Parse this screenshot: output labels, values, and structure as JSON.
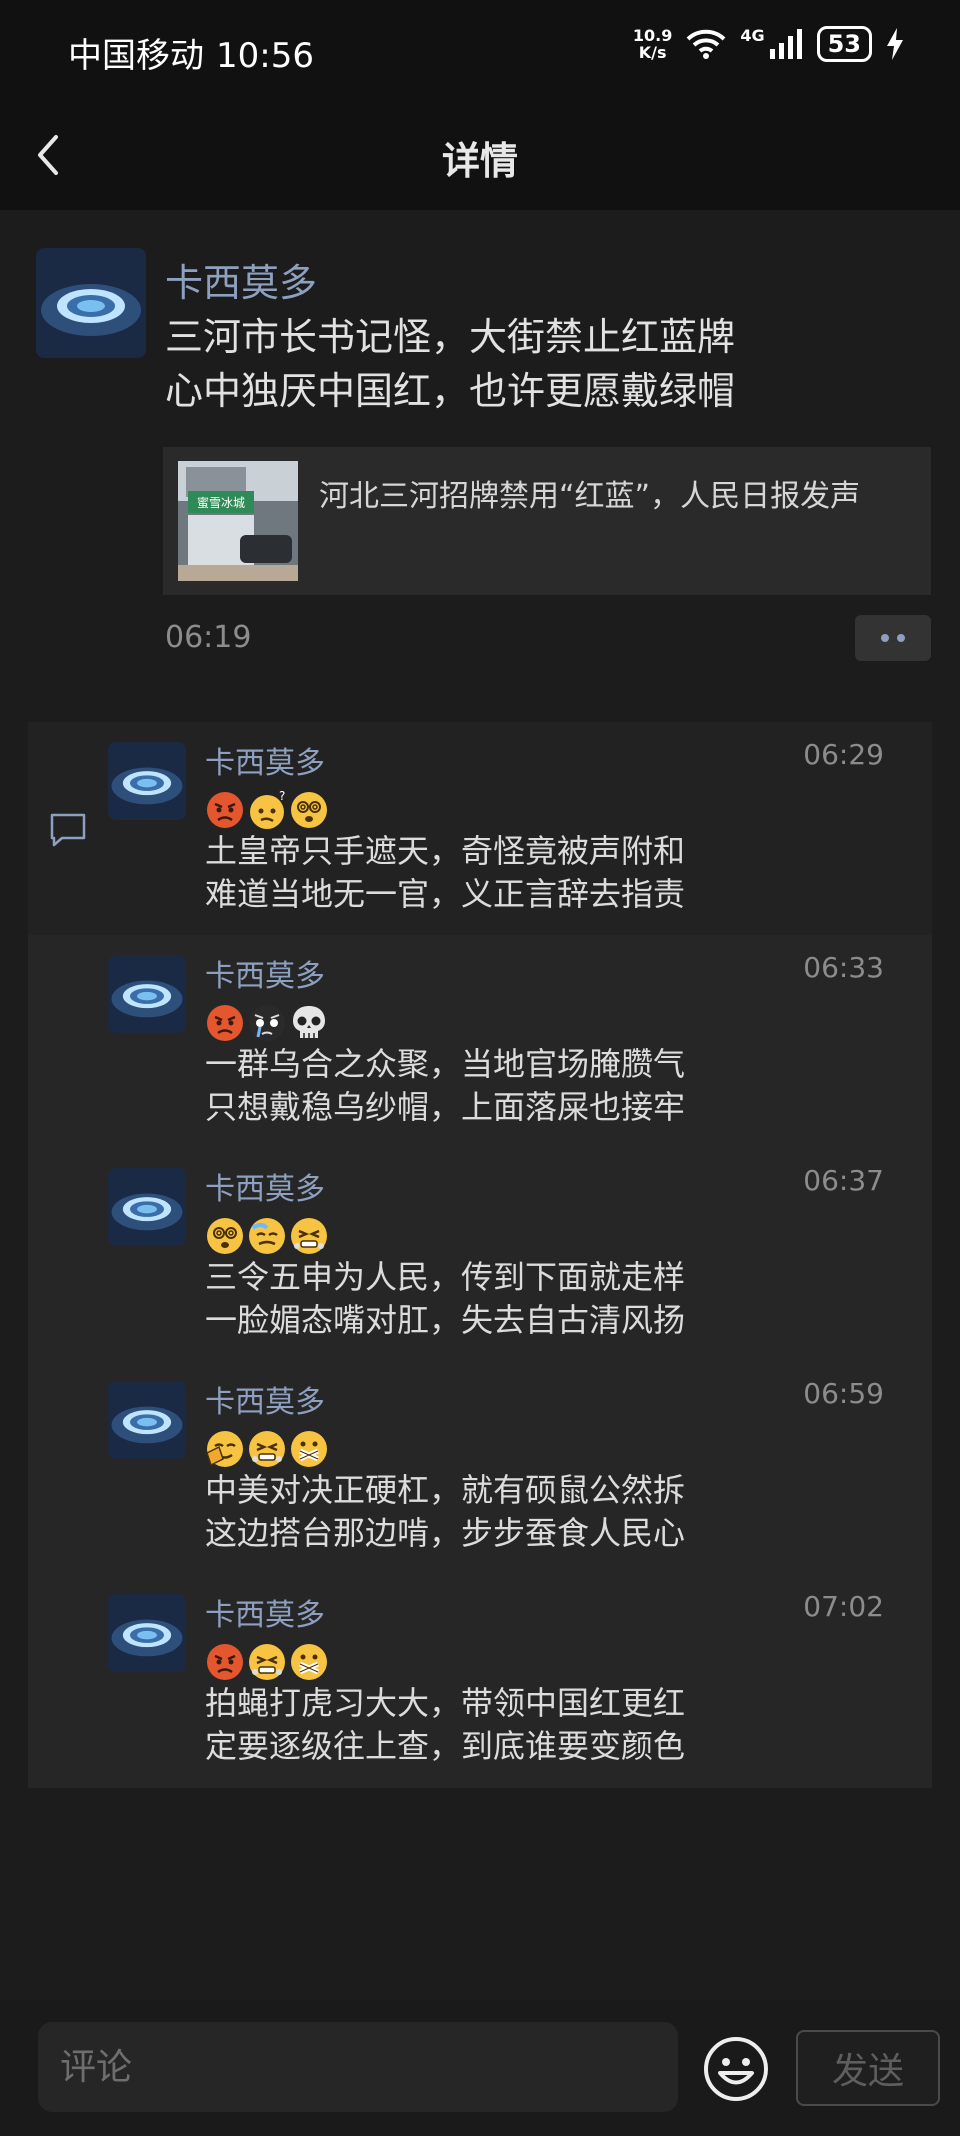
{
  "status_bar": {
    "carrier": "中国移动",
    "time": "10:56",
    "net_speed_value": "10.9",
    "net_speed_unit": "K/s",
    "network_type": "4G",
    "battery": "53"
  },
  "header": {
    "title": "详情",
    "back_icon": "chevron-left-icon"
  },
  "post": {
    "author": "卡西莫多",
    "text_line1": "三河市长书记怪，大街禁止红蓝牌",
    "text_line2": "心中独厌中国红，也许更愿戴绿帽",
    "link_title": "河北三河招牌禁用“红蓝”，人民日报发声",
    "thumb_sign_text": "蜜雪冰城",
    "time": "06:19"
  },
  "comments": [
    {
      "author": "卡西莫多",
      "time": "06:29",
      "emojis": [
        "angry-face-icon",
        "confused-face-icon",
        "dizzy-face-icon"
      ],
      "line1": "土皇帝只手遮天，奇怪竟被声附和",
      "line2": "难道当地无一官，义正言辞去指责"
    },
    {
      "author": "卡西莫多",
      "time": "06:33",
      "emojis": [
        "angry-face-icon",
        "crying-face-icon",
        "skull-icon"
      ],
      "line1": "一群乌合之众聚，当地官场腌臜气",
      "line2": "只想戴稳乌纱帽，上面落屎也接牢"
    },
    {
      "author": "卡西莫多",
      "time": "06:37",
      "emojis": [
        "dizzy-face-icon",
        "sweat-face-icon",
        "triumph-face-icon"
      ],
      "line1": "三令五申为人民，传到下面就走样",
      "line2": "一脸媚态嘴对肛，失去自古清风扬"
    },
    {
      "author": "卡西莫多",
      "time": "06:59",
      "emojis": [
        "facepalm-icon",
        "triumph-face-icon",
        "zipped-mouth-icon"
      ],
      "line1": "中美对决正硬杠，就有硕鼠公然拆",
      "line2": "这边搭台那边啃，步步蚕食人民心"
    },
    {
      "author": "卡西莫多",
      "time": "07:02",
      "emojis": [
        "angry-face-icon",
        "triumph-face-icon",
        "zipped-mouth-icon"
      ],
      "line1": "拍蝇打虎习大大，带领中国红更红",
      "line2": "定要逐级往上查，到底谁要变颜色"
    }
  ],
  "bottom_bar": {
    "input_placeholder": "评论",
    "emoji_button_icon": "smiley-icon",
    "send_label": "发送"
  },
  "colors": {
    "background": "#1c1c1c",
    "author_name": "#8ea0bf",
    "comment_panel": "#262626"
  }
}
